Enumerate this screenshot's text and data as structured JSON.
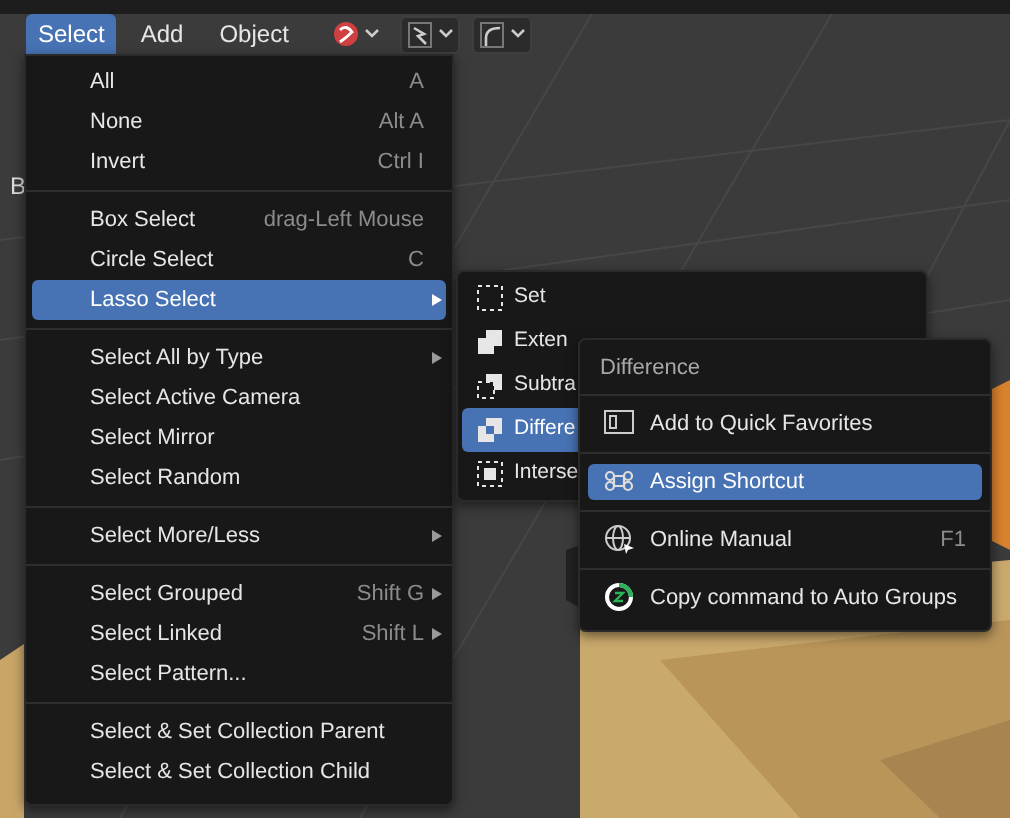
{
  "header": {
    "tabs": [
      {
        "label": "Select",
        "selected": true
      },
      {
        "label": "Add",
        "selected": false
      },
      {
        "label": "Object",
        "selected": false
      }
    ]
  },
  "viewport_label": "B",
  "select_menu": {
    "groups": [
      [
        {
          "label": "All",
          "shortcut": "A",
          "submenu": false,
          "selected": false
        },
        {
          "label": "None",
          "shortcut": "Alt A",
          "submenu": false,
          "selected": false
        },
        {
          "label": "Invert",
          "shortcut": "Ctrl I",
          "submenu": false,
          "selected": false
        }
      ],
      [
        {
          "label": "Box Select",
          "shortcut": "drag-Left Mouse",
          "submenu": false,
          "selected": false
        },
        {
          "label": "Circle Select",
          "shortcut": "C",
          "submenu": false,
          "selected": false
        },
        {
          "label": "Lasso Select",
          "submenu": true,
          "selected": true
        }
      ],
      [
        {
          "label": "Select All by Type",
          "submenu": true,
          "selected": false
        },
        {
          "label": "Select Active Camera",
          "submenu": false,
          "selected": false
        },
        {
          "label": "Select Mirror",
          "submenu": false,
          "selected": false
        },
        {
          "label": "Select Random",
          "submenu": false,
          "selected": false
        }
      ],
      [
        {
          "label": "Select More/Less",
          "submenu": true,
          "selected": false
        }
      ],
      [
        {
          "label": "Select Grouped",
          "shortcut": "Shift G",
          "submenu": true,
          "selected": false
        },
        {
          "label": "Select Linked",
          "shortcut": "Shift L",
          "submenu": true,
          "selected": false
        },
        {
          "label": "Select Pattern...",
          "submenu": false,
          "selected": false
        }
      ],
      [
        {
          "label": "Select & Set Collection Parent",
          "submenu": false,
          "selected": false
        },
        {
          "label": "Select & Set Collection Child",
          "submenu": false,
          "selected": false
        }
      ]
    ]
  },
  "lasso_menu": {
    "items": [
      {
        "kind": "set",
        "label": "Set",
        "selected": false
      },
      {
        "kind": "extend",
        "label": "Exten",
        "selected": false
      },
      {
        "kind": "subtract",
        "label": "Subtra",
        "selected": false
      },
      {
        "kind": "difference",
        "label": "Differe",
        "selected": true
      },
      {
        "kind": "intersect",
        "label": "Interse",
        "selected": false
      }
    ]
  },
  "context_menu": {
    "title": "Difference",
    "items": [
      {
        "kind": "favorites",
        "label": "Add to Quick Favorites",
        "selected": false
      },
      {
        "kind": "shortcut",
        "label": "Assign Shortcut",
        "selected": true
      },
      {
        "kind": "manual",
        "label": "Online Manual",
        "shortcut": "F1",
        "selected": false
      },
      {
        "kind": "autogroups",
        "label": "Copy command to Auto Groups",
        "selected": false
      }
    ]
  }
}
